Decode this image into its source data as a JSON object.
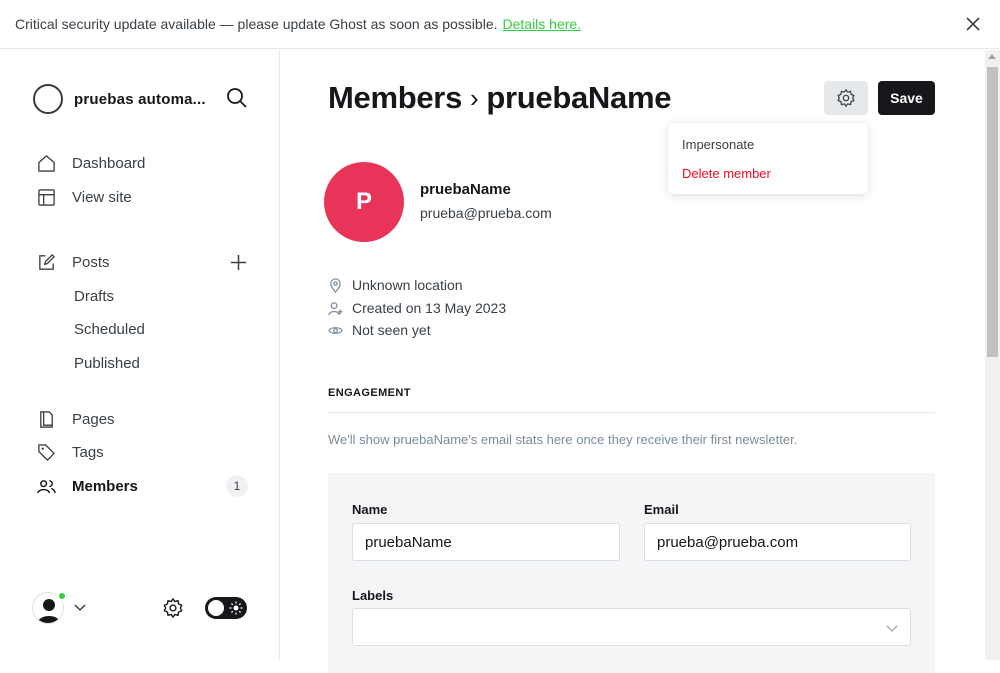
{
  "banner": {
    "text": "Critical security update available — please update Ghost as soon as possible.",
    "link": "Details here."
  },
  "sidebar": {
    "site_name": "pruebas automa...",
    "nav": {
      "dashboard": "Dashboard",
      "view_site": "View site",
      "posts": "Posts",
      "drafts": "Drafts",
      "scheduled": "Scheduled",
      "published": "Published",
      "pages": "Pages",
      "tags": "Tags",
      "members": "Members",
      "members_count": "1"
    }
  },
  "header": {
    "breadcrumb_parent": "Members",
    "breadcrumb_sep": "›",
    "breadcrumb_current": "pruebaName",
    "save_label": "Save"
  },
  "dropdown": {
    "impersonate": "Impersonate",
    "delete": "Delete member"
  },
  "member": {
    "initial": "P",
    "name": "pruebaName",
    "email": "prueba@prueba.com",
    "location": "Unknown location",
    "created": "Created on 13 May 2023",
    "seen": "Not seen yet"
  },
  "engagement": {
    "heading": "ENGAGEMENT",
    "hint": "We'll show pruebaName's email stats here once they receive their first newsletter."
  },
  "form": {
    "name_label": "Name",
    "name_value": "pruebaName",
    "email_label": "Email",
    "email_value": "prueba@prueba.com",
    "labels_label": "Labels",
    "labels_value": ""
  },
  "colors": {
    "accent_green": "#30cf43",
    "avatar_pink": "#e83458",
    "danger_red": "#f50b23",
    "primary_dark": "#15171a"
  }
}
